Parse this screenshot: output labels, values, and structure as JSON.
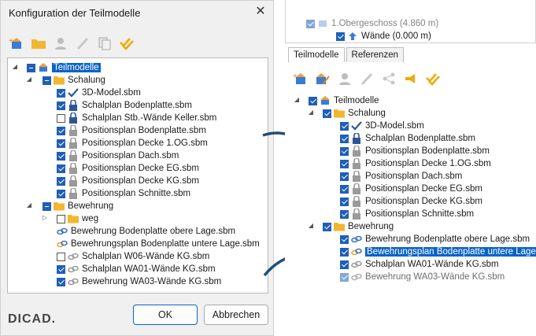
{
  "dialog": {
    "title": "Konfiguration der Teilmodelle",
    "ok_label": "OK",
    "cancel_label": "Abbrechen",
    "logo_text": "DICAD."
  },
  "left_tree": {
    "root": "Teilmodelle",
    "schalung": "Schalung",
    "schalung_items": [
      "3D-Model.sbm",
      "Schalplan Bodenplatte.sbm",
      "Schalplan Stb.-Wände Keller.sbm",
      "Positionsplan Bodenplatte.sbm",
      "Positionsplan Decke 1.OG.sbm",
      "Positionsplan Dach.sbm",
      "Positionsplan Decke EG.sbm",
      "Positionsplan Decke KG.sbm",
      "Positionsplan Schnitte.sbm"
    ],
    "bewehrung": "Bewehrung",
    "weg": "weg",
    "bewehrung_items": [
      "Bewehrung Bodenplatte obere Lage.sbm",
      "Bewehrungsplan Bodenplatte untere Lage.sbm",
      "Schalplan W06-Wände KG.sbm",
      "Schalplan WA01-Wände KG.sbm",
      "Bewehrung WA03-Wände KG.sbm"
    ]
  },
  "right_panel": {
    "top_item1": "1.Obergeschoss (4.860 m)",
    "top_item2": "Wände (0.000 m)",
    "tab1": "Teilmodelle",
    "tab2": "Referenzen",
    "root": "Teilmodelle",
    "schalung": "Schalung",
    "schalung_items": [
      "3D-Model.sbm",
      "Schalplan Bodenplatte.sbm",
      "Positionsplan Bodenplatte.sbm",
      "Positionsplan Decke 1.OG.sbm",
      "Positionsplan Dach.sbm",
      "Positionsplan Decke EG.sbm",
      "Positionsplan Decke KG.sbm",
      "Positionsplan Schnitte.sbm"
    ],
    "bewehrung": "Bewehrung",
    "bewehrung_items": [
      "Bewehrung Bodenplatte obere Lage.sbm",
      "Bewehrungsplan Bodenplatte untere Lage",
      "Schalplan WA01-Wände KG.sbm",
      "Bewehrung WA03-Wände KG.sbm"
    ]
  },
  "colors": {
    "accent": "#0a64c8",
    "checkbox": "#1f5fb7",
    "folder": "#f2b630",
    "lock": "#2f5597",
    "link": "#3a6fc4"
  }
}
